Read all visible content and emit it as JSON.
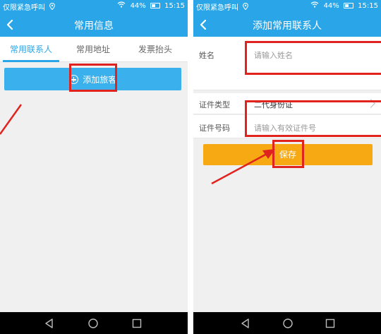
{
  "status_bar": {
    "carrier": "仅限紧急呼叫",
    "battery": "44%",
    "time": "15:15"
  },
  "left_screen": {
    "title": "常用信息",
    "tabs": [
      {
        "label": "常用联系人",
        "active": true
      },
      {
        "label": "常用地址",
        "active": false
      },
      {
        "label": "发票抬头",
        "active": false
      }
    ],
    "add_button_label": "添加旅客"
  },
  "right_screen": {
    "title": "添加常用联系人",
    "fields": [
      {
        "label": "姓名",
        "value": "",
        "placeholder": "请输入姓名"
      },
      {
        "label": "证件类型",
        "value": "二代身份证"
      },
      {
        "label": "证件号码",
        "value": "",
        "placeholder": "请输入有效证件号"
      }
    ],
    "save_label": "保存"
  },
  "colors": {
    "accent": "#2aa6e8",
    "save": "#f6a913",
    "highlight": "#e0231f"
  },
  "icons": [
    "back-icon",
    "location-icon",
    "wifi-icon",
    "battery-icon",
    "add-circle-icon",
    "chevron-right-icon",
    "nav-back-icon",
    "nav-home-icon",
    "nav-recent-icon"
  ]
}
